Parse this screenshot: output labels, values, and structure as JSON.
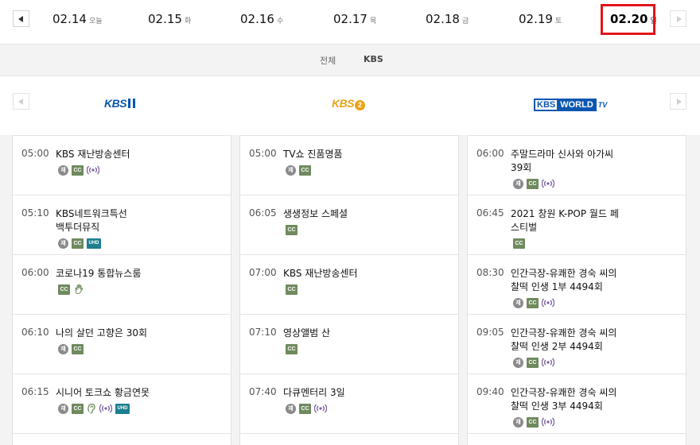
{
  "dates": [
    {
      "date": "02.14",
      "weekday": "오늘"
    },
    {
      "date": "02.15",
      "weekday": "화"
    },
    {
      "date": "02.16",
      "weekday": "수"
    },
    {
      "date": "02.17",
      "weekday": "목"
    },
    {
      "date": "02.18",
      "weekday": "금"
    },
    {
      "date": "02.19",
      "weekday": "토"
    },
    {
      "date": "02.20",
      "weekday": "일"
    }
  ],
  "selected_date_index": 6,
  "filter": {
    "all": "전체",
    "kbs": "KBS"
  },
  "channels": {
    "kbs1": {
      "logo_text": "KBS"
    },
    "kbs2": {
      "logo_text": "KBS",
      "number": "2"
    },
    "kbsw": {
      "logo_text_1": "KBS",
      "logo_text_2": "WORLD",
      "logo_text_3": "TV"
    }
  },
  "icon_labels": {
    "rerun": "재",
    "cc": "CC",
    "uhd": "UHD"
  },
  "colors": {
    "highlight": "#e3141b",
    "kbs_blue": "#0a56b0",
    "kbs2_orange": "#e8a317",
    "cc_green": "#6f8a5e",
    "uhd_teal": "#1c7f8f"
  },
  "columns": {
    "kbs1": [
      {
        "time": "05:00",
        "title": "KBS 재난방송센터",
        "icons": [
          "rerun-icon",
          "cc-icon",
          "broadcast-icon"
        ]
      },
      {
        "time": "05:10",
        "title": "KBS네트워크특선 백투더뮤직",
        "icons": [
          "rerun-icon",
          "cc-icon",
          "uhd-icon"
        ]
      },
      {
        "time": "06:00",
        "title": "코로나19 통합뉴스룸",
        "icons": [
          "cc-icon",
          "sign-language-icon"
        ]
      },
      {
        "time": "06:10",
        "title": "나의 살던 고향은 30회",
        "icons": [
          "rerun-icon",
          "cc-icon"
        ]
      },
      {
        "time": "06:15",
        "title": "시니어 토크쇼 황금연못",
        "icons": [
          "rerun-icon",
          "cc-icon",
          "audio-description-icon",
          "broadcast-icon",
          "uhd-icon"
        ]
      }
    ],
    "kbs2": [
      {
        "time": "05:00",
        "title": "TV쇼 진품명품",
        "icons": [
          "rerun-icon",
          "cc-icon"
        ]
      },
      {
        "time": "06:05",
        "title": "생생정보 스페셜",
        "icons": [
          "cc-icon"
        ]
      },
      {
        "time": "07:00",
        "title": "KBS 재난방송센터",
        "icons": [
          "cc-icon"
        ]
      },
      {
        "time": "07:10",
        "title": "영상앨범 산",
        "icons": [
          "cc-icon"
        ]
      },
      {
        "time": "07:40",
        "title": "다큐멘터리 3일",
        "icons": [
          "rerun-icon",
          "cc-icon",
          "broadcast-icon"
        ]
      }
    ],
    "kbsw": [
      {
        "time": "06:00",
        "title": "주말드라마 신사와 아가씨 39회",
        "icons": [
          "rerun-icon",
          "cc-icon",
          "broadcast-icon"
        ]
      },
      {
        "time": "06:45",
        "title": "2021 창원 K-POP 월드 페스티벌",
        "icons": [
          "cc-icon"
        ]
      },
      {
        "time": "08:30",
        "title": "인간극장-유쾌한 경숙 씨의 찰떡 인생 1부 4494회",
        "icons": [
          "rerun-icon",
          "cc-icon",
          "broadcast-icon"
        ]
      },
      {
        "time": "09:05",
        "title": "인간극장-유쾌한 경숙 씨의 찰떡 인생 2부 4494회",
        "icons": [
          "rerun-icon",
          "cc-icon",
          "broadcast-icon"
        ]
      },
      {
        "time": "09:40",
        "title": "인간극장-유쾌한 경숙 씨의 찰떡 인생 3부 4494회",
        "icons": [
          "rerun-icon",
          "cc-icon",
          "broadcast-icon"
        ]
      }
    ]
  }
}
